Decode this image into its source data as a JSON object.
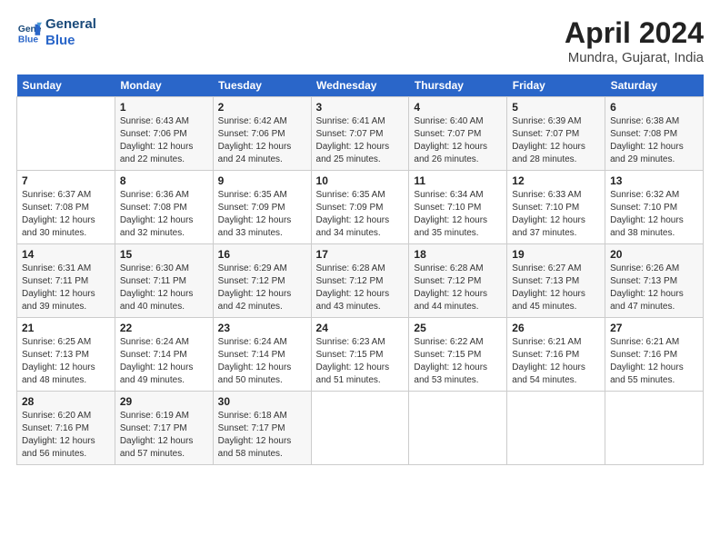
{
  "header": {
    "logo_line1": "General",
    "logo_line2": "Blue",
    "title": "April 2024",
    "subtitle": "Mundra, Gujarat, India"
  },
  "days_header": [
    "Sunday",
    "Monday",
    "Tuesday",
    "Wednesday",
    "Thursday",
    "Friday",
    "Saturday"
  ],
  "weeks": [
    [
      {
        "day": "",
        "text": ""
      },
      {
        "day": "1",
        "text": "Sunrise: 6:43 AM\nSunset: 7:06 PM\nDaylight: 12 hours\nand 22 minutes."
      },
      {
        "day": "2",
        "text": "Sunrise: 6:42 AM\nSunset: 7:06 PM\nDaylight: 12 hours\nand 24 minutes."
      },
      {
        "day": "3",
        "text": "Sunrise: 6:41 AM\nSunset: 7:07 PM\nDaylight: 12 hours\nand 25 minutes."
      },
      {
        "day": "4",
        "text": "Sunrise: 6:40 AM\nSunset: 7:07 PM\nDaylight: 12 hours\nand 26 minutes."
      },
      {
        "day": "5",
        "text": "Sunrise: 6:39 AM\nSunset: 7:07 PM\nDaylight: 12 hours\nand 28 minutes."
      },
      {
        "day": "6",
        "text": "Sunrise: 6:38 AM\nSunset: 7:08 PM\nDaylight: 12 hours\nand 29 minutes."
      }
    ],
    [
      {
        "day": "7",
        "text": "Sunrise: 6:37 AM\nSunset: 7:08 PM\nDaylight: 12 hours\nand 30 minutes."
      },
      {
        "day": "8",
        "text": "Sunrise: 6:36 AM\nSunset: 7:08 PM\nDaylight: 12 hours\nand 32 minutes."
      },
      {
        "day": "9",
        "text": "Sunrise: 6:35 AM\nSunset: 7:09 PM\nDaylight: 12 hours\nand 33 minutes."
      },
      {
        "day": "10",
        "text": "Sunrise: 6:35 AM\nSunset: 7:09 PM\nDaylight: 12 hours\nand 34 minutes."
      },
      {
        "day": "11",
        "text": "Sunrise: 6:34 AM\nSunset: 7:10 PM\nDaylight: 12 hours\nand 35 minutes."
      },
      {
        "day": "12",
        "text": "Sunrise: 6:33 AM\nSunset: 7:10 PM\nDaylight: 12 hours\nand 37 minutes."
      },
      {
        "day": "13",
        "text": "Sunrise: 6:32 AM\nSunset: 7:10 PM\nDaylight: 12 hours\nand 38 minutes."
      }
    ],
    [
      {
        "day": "14",
        "text": "Sunrise: 6:31 AM\nSunset: 7:11 PM\nDaylight: 12 hours\nand 39 minutes."
      },
      {
        "day": "15",
        "text": "Sunrise: 6:30 AM\nSunset: 7:11 PM\nDaylight: 12 hours\nand 40 minutes."
      },
      {
        "day": "16",
        "text": "Sunrise: 6:29 AM\nSunset: 7:12 PM\nDaylight: 12 hours\nand 42 minutes."
      },
      {
        "day": "17",
        "text": "Sunrise: 6:28 AM\nSunset: 7:12 PM\nDaylight: 12 hours\nand 43 minutes."
      },
      {
        "day": "18",
        "text": "Sunrise: 6:28 AM\nSunset: 7:12 PM\nDaylight: 12 hours\nand 44 minutes."
      },
      {
        "day": "19",
        "text": "Sunrise: 6:27 AM\nSunset: 7:13 PM\nDaylight: 12 hours\nand 45 minutes."
      },
      {
        "day": "20",
        "text": "Sunrise: 6:26 AM\nSunset: 7:13 PM\nDaylight: 12 hours\nand 47 minutes."
      }
    ],
    [
      {
        "day": "21",
        "text": "Sunrise: 6:25 AM\nSunset: 7:13 PM\nDaylight: 12 hours\nand 48 minutes."
      },
      {
        "day": "22",
        "text": "Sunrise: 6:24 AM\nSunset: 7:14 PM\nDaylight: 12 hours\nand 49 minutes."
      },
      {
        "day": "23",
        "text": "Sunrise: 6:24 AM\nSunset: 7:14 PM\nDaylight: 12 hours\nand 50 minutes."
      },
      {
        "day": "24",
        "text": "Sunrise: 6:23 AM\nSunset: 7:15 PM\nDaylight: 12 hours\nand 51 minutes."
      },
      {
        "day": "25",
        "text": "Sunrise: 6:22 AM\nSunset: 7:15 PM\nDaylight: 12 hours\nand 53 minutes."
      },
      {
        "day": "26",
        "text": "Sunrise: 6:21 AM\nSunset: 7:16 PM\nDaylight: 12 hours\nand 54 minutes."
      },
      {
        "day": "27",
        "text": "Sunrise: 6:21 AM\nSunset: 7:16 PM\nDaylight: 12 hours\nand 55 minutes."
      }
    ],
    [
      {
        "day": "28",
        "text": "Sunrise: 6:20 AM\nSunset: 7:16 PM\nDaylight: 12 hours\nand 56 minutes."
      },
      {
        "day": "29",
        "text": "Sunrise: 6:19 AM\nSunset: 7:17 PM\nDaylight: 12 hours\nand 57 minutes."
      },
      {
        "day": "30",
        "text": "Sunrise: 6:18 AM\nSunset: 7:17 PM\nDaylight: 12 hours\nand 58 minutes."
      },
      {
        "day": "",
        "text": ""
      },
      {
        "day": "",
        "text": ""
      },
      {
        "day": "",
        "text": ""
      },
      {
        "day": "",
        "text": ""
      }
    ]
  ]
}
